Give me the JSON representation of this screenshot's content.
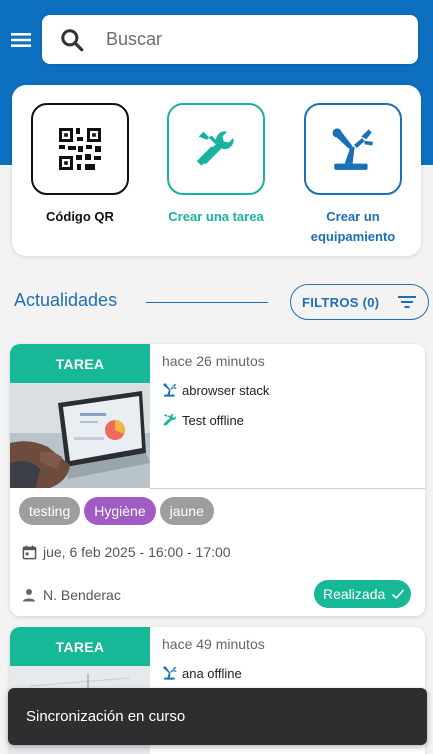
{
  "header": {
    "menu_icon": "menu-icon",
    "search": {
      "placeholder": "Buscar",
      "value": "",
      "icon": "search-icon"
    }
  },
  "quick_actions": [
    {
      "label": "Código QR",
      "icon": "qr-code-icon",
      "color": "#111111"
    },
    {
      "label": "Crear una tarea",
      "icon": "tools-icon",
      "color": "#17b3a0"
    },
    {
      "label": "Crear un equipamiento",
      "icon": "equipment-icon",
      "color": "#1a6fb7"
    }
  ],
  "feed": {
    "title": "Actualidades",
    "filter_label": "FILTROS (0)",
    "filter_icon": "filter-lines-icon"
  },
  "cards": [
    {
      "type_label": "TAREA",
      "time": "hace 26 minutos",
      "equipment": "abrowser stack",
      "task": "Test offline",
      "tags": [
        {
          "label": "testing",
          "color": "#9e9e9e"
        },
        {
          "label": "Hygiène",
          "color": "#a05bc5"
        },
        {
          "label": "jaune",
          "color": "#9e9e9e"
        }
      ],
      "date": "jue, 6 feb 2025 - 16:00 - 17:00",
      "user": "N. Benderac",
      "status": "Realizada"
    },
    {
      "type_label": "TAREA",
      "time": "hace 49 minutos",
      "equipment": "ana offline"
    }
  ],
  "snackbar": {
    "message": "Sincronización en curso"
  },
  "colors": {
    "primary_blue": "#0d6fbf",
    "teal": "#17b897",
    "purple_tag": "#a05bc5",
    "snackbar_bg": "#2d2e30"
  }
}
